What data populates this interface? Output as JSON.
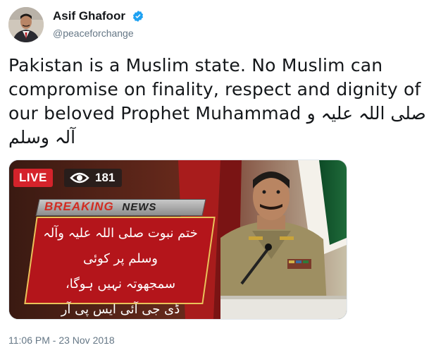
{
  "author": {
    "display_name": "Asif Ghafoor",
    "handle": "@peaceforchange",
    "verified": true
  },
  "tweet": {
    "text_en": "Pakistan is a Muslim state. No Muslim can compromise on finality, respect and dignity of our beloved Prophet Muhammad",
    "text_ar": "صلی اللہ علیہ و آلہ وسلم",
    "timestamp": "11:06 PM - 23 Nov 2018"
  },
  "media": {
    "live_label": "LIVE",
    "view_count": "181",
    "breaking": "BREAKING",
    "news": "NEWS",
    "urdu_line1": "ختم نبوت صلی اللہ علیہ وآلہ وسلم پر کوئی",
    "urdu_line2": "سمجھوتہ نہیں ہوگا،",
    "urdu_line3": "ڈی جی آئی ایس پی آر"
  },
  "colors": {
    "verified_blue": "#1da1f2",
    "live_red": "#d5232b",
    "text_primary": "#14171a",
    "text_secondary": "#657786"
  },
  "icons": [
    "verified-badge-icon",
    "eye-icon"
  ]
}
